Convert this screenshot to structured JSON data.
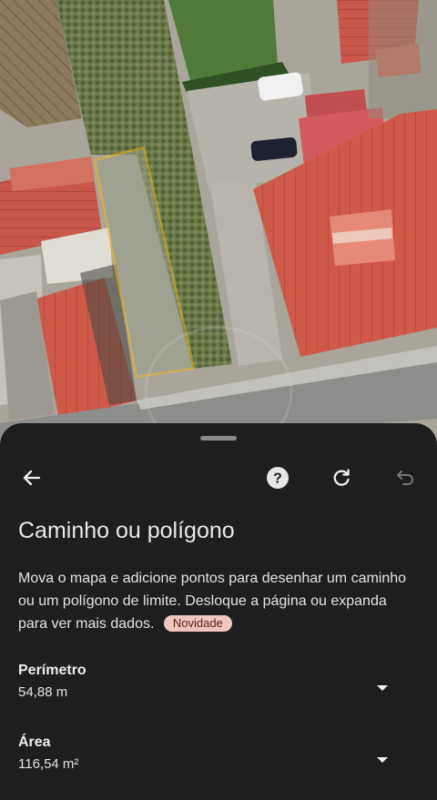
{
  "panel": {
    "title": "Caminho ou polígono",
    "description": "Mova o mapa e adicione pontos para desenhar um caminho ou um polígono de limite. Desloque a página ou expanda para ver mais dados.",
    "badge": "Novidade",
    "help_label": "?"
  },
  "metrics": [
    {
      "label": "Perímetro",
      "value": "54,88 m"
    },
    {
      "label": "Área",
      "value": "116,54 m²"
    }
  ],
  "icons": {
    "back": "arrow-left-icon",
    "help": "help-icon",
    "refresh": "refresh-icon",
    "undo": "undo-icon",
    "expand": "chevron-down-icon"
  },
  "colors": {
    "sheet_bg": "#1e1e1e",
    "polygon_outline": "#f2b51a",
    "badge_bg": "#f2c6c0",
    "undo_disabled": "#777777"
  }
}
